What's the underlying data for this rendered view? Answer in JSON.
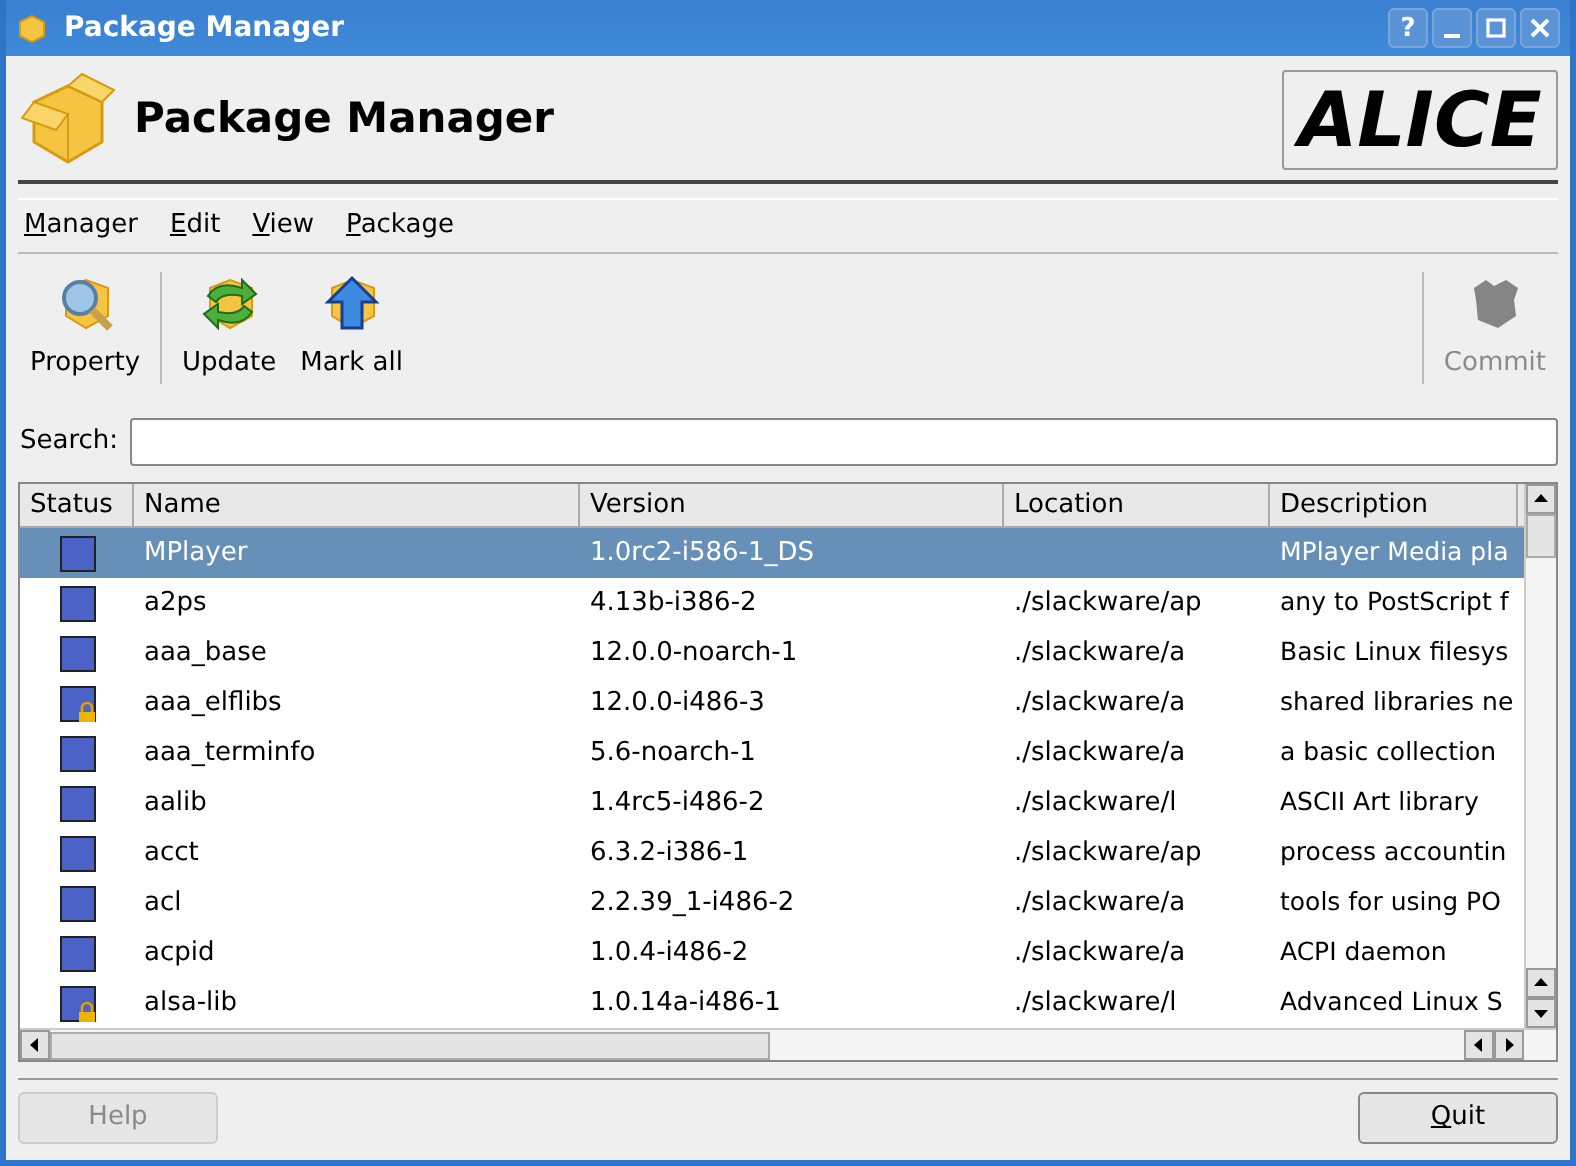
{
  "window": {
    "title": "Package Manager"
  },
  "title_buttons": [
    {
      "kind": "help",
      "label": "?"
    },
    {
      "kind": "minimize"
    },
    {
      "kind": "maximize"
    },
    {
      "kind": "close"
    }
  ],
  "header": {
    "title": "Package Manager",
    "logo": "ALICE"
  },
  "menu": [
    {
      "label": "Manager",
      "mnemonic": true
    },
    {
      "label": "Edit",
      "mnemonic": true
    },
    {
      "label": "View",
      "mnemonic": true
    },
    {
      "label": "Package",
      "mnemonic": true
    }
  ],
  "toolbar": [
    {
      "kind": "property",
      "label": "Property",
      "disabled": false
    },
    {
      "kind": "update",
      "label": "Update",
      "disabled": false
    },
    {
      "kind": "markall",
      "label": "Mark all",
      "disabled": false
    },
    {
      "kind": "commit",
      "label": "Commit",
      "disabled": true
    }
  ],
  "search": {
    "label": "Search:"
  },
  "table": {
    "columns": [
      "Status",
      "Name",
      "Version",
      "Location",
      "Description"
    ],
    "rows": [
      {
        "kind": "installed",
        "name": "MPlayer",
        "version": "1.0rc2-i586-1_DS",
        "location": "",
        "description": "MPlayer Media pla",
        "selected": true
      },
      {
        "kind": "installed",
        "name": "a2ps",
        "version": "4.13b-i386-2",
        "location": "./slackware/ap",
        "description": "any to PostScript f",
        "selected": false
      },
      {
        "kind": "installed",
        "name": "aaa_base",
        "version": "12.0.0-noarch-1",
        "location": "./slackware/a",
        "description": "Basic Linux filesys",
        "selected": false
      },
      {
        "kind": "locked",
        "name": "aaa_elflibs",
        "version": "12.0.0-i486-3",
        "location": "./slackware/a",
        "description": "shared libraries ne",
        "selected": false
      },
      {
        "kind": "installed",
        "name": "aaa_terminfo",
        "version": "5.6-noarch-1",
        "location": "./slackware/a",
        "description": "a basic collection",
        "selected": false
      },
      {
        "kind": "installed",
        "name": "aalib",
        "version": "1.4rc5-i486-2",
        "location": "./slackware/l",
        "description": "ASCII Art library",
        "selected": false
      },
      {
        "kind": "installed",
        "name": "acct",
        "version": "6.3.2-i386-1",
        "location": "./slackware/ap",
        "description": "process accountin",
        "selected": false
      },
      {
        "kind": "installed",
        "name": "acl",
        "version": "2.2.39_1-i486-2",
        "location": "./slackware/a",
        "description": "tools for using PO",
        "selected": false
      },
      {
        "kind": "installed",
        "name": "acpid",
        "version": "1.0.4-i486-2",
        "location": "./slackware/a",
        "description": "ACPI daemon",
        "selected": false
      },
      {
        "kind": "locked",
        "name": "alsa-lib",
        "version": "1.0.14a-i486-1",
        "location": "./slackware/l",
        "description": "Advanced Linux S",
        "selected": false
      }
    ]
  },
  "buttons": [
    {
      "label": "Help",
      "mnemonic": false,
      "disabled": true
    },
    {
      "label": "Quit",
      "mnemonic": true,
      "disabled": false
    }
  ]
}
